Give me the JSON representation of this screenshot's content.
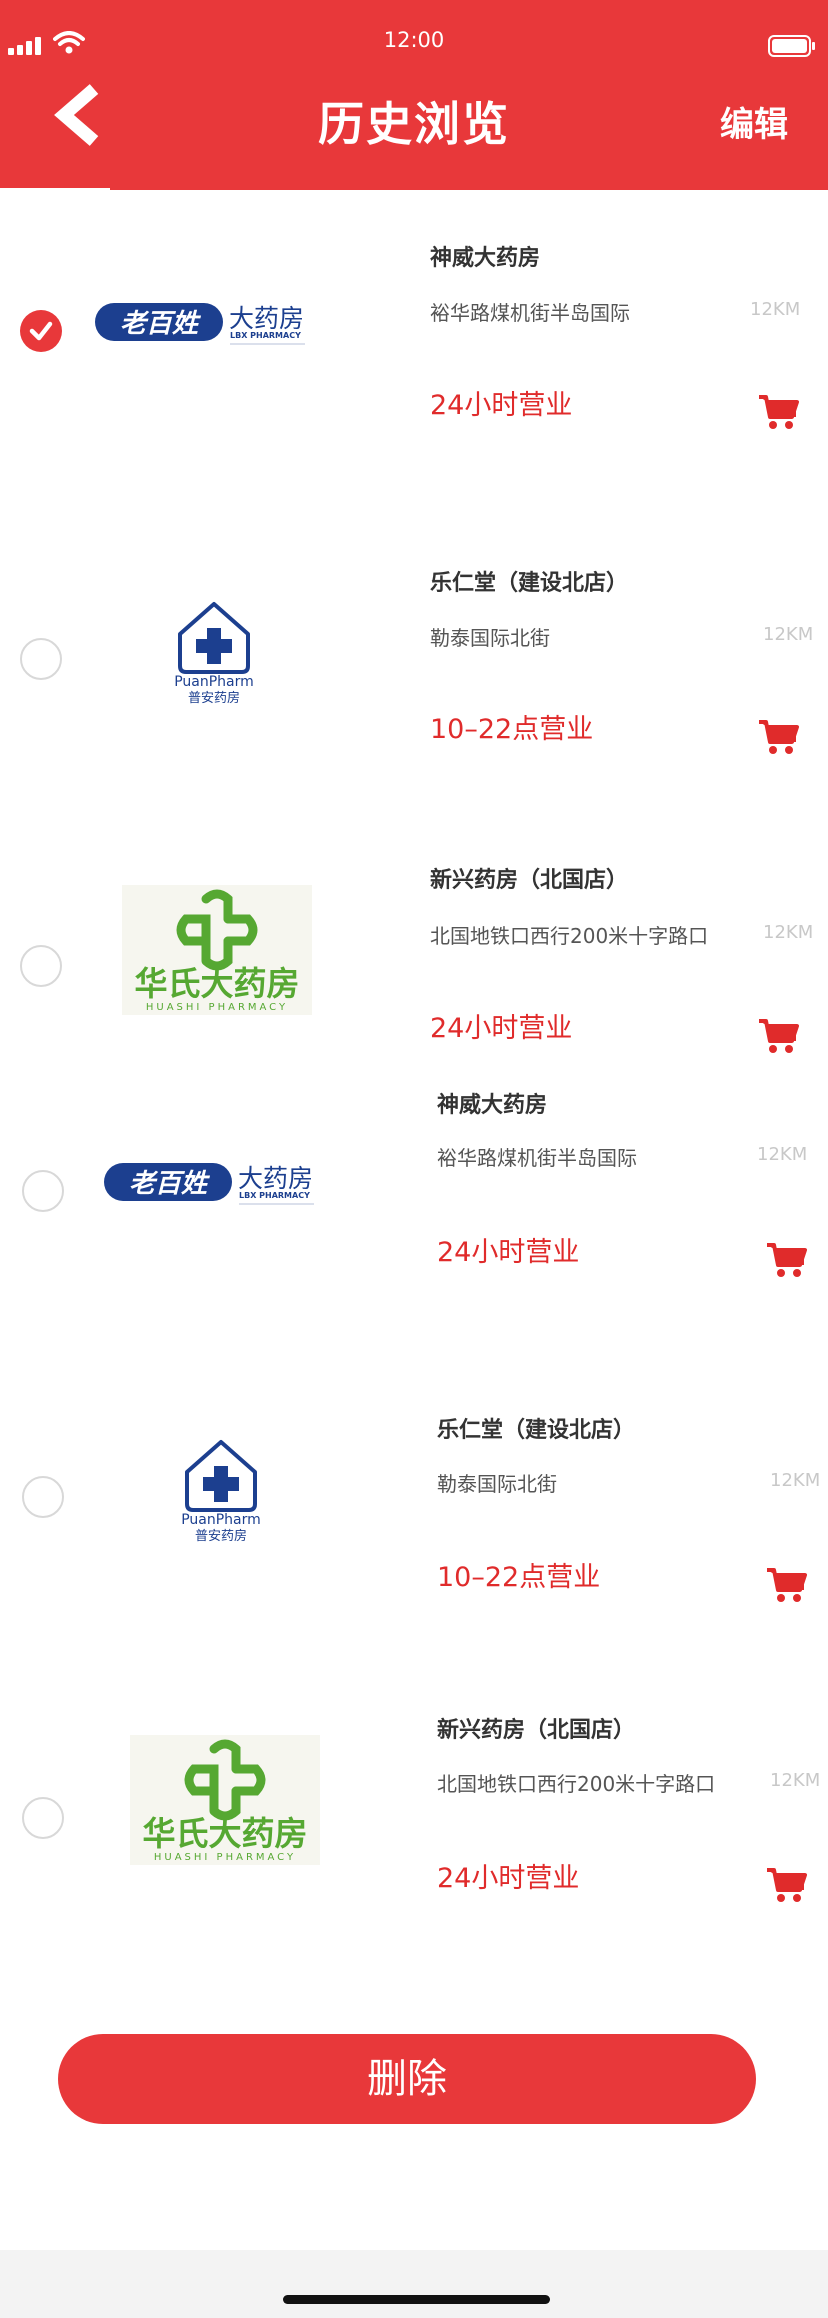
{
  "status_bar": {
    "time": "12:00"
  },
  "header": {
    "title": "历史浏览",
    "edit_label": "编辑"
  },
  "stores": [
    {
      "name": "神威大药房",
      "address": "裕华路煤机街半岛国际",
      "distance": "12KM",
      "hours": "24小时营业",
      "logo": "laobaixing",
      "selected": true
    },
    {
      "name": "乐仁堂（建设北店）",
      "address": "勒泰国际北街",
      "distance": "12KM",
      "hours": "10–22点营业",
      "logo": "puan",
      "selected": false
    },
    {
      "name": "新兴药房（北国店）",
      "address": "北国地铁口西行200米十字路口",
      "distance": "12KM",
      "hours": "24小时营业",
      "logo": "huashi",
      "selected": false
    },
    {
      "name": "神威大药房",
      "address": "裕华路煤机街半岛国际",
      "distance": "12KM",
      "hours": "24小时营业",
      "logo": "laobaixing",
      "selected": false
    },
    {
      "name": "乐仁堂（建设北店）",
      "address": "勒泰国际北街",
      "distance": "12KM",
      "hours": "10–22点营业",
      "logo": "puan",
      "selected": false
    },
    {
      "name": "新兴药房（北国店）",
      "address": "北国地铁口西行200米十字路口",
      "distance": "12KM",
      "hours": "24小时营业",
      "logo": "huashi",
      "selected": false
    }
  ],
  "logos": {
    "laobaixing": {
      "brand": "老百姓",
      "suffix": "大药房",
      "english": "LBX PHARMACY"
    },
    "puan": {
      "english": "PuanPharm",
      "chinese": "普安药房"
    },
    "huashi": {
      "chinese": "华氏大药房",
      "english": "HUASHI PHARMACY"
    }
  },
  "delete_label": "删除",
  "colors": {
    "primary": "#e8383a",
    "hours_text": "#e02b2b"
  }
}
